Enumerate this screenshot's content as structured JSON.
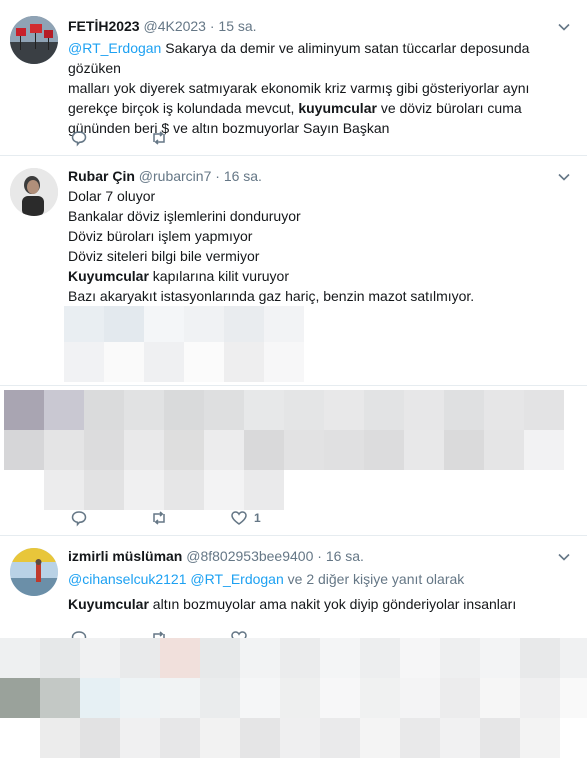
{
  "tweets": [
    {
      "fullname": "FETİH2023",
      "handle": "@4K2023",
      "sep": "·",
      "time": "15 sa.",
      "mention": "@RT_Erdogan",
      "lines": [
        " Sakarya da demir ve aliminyum satan tüccarlar deposunda gözüken",
        "malları yok diyerek satmıyarak ekonomik kriz varmış gibi gösteriyorlar aynı",
        "gerekçe birçok iş kolundada mevcut, ",
        "kuyumcular",
        " ve döviz büroları cuma",
        "gününden beri $ ve altın bozmuyorlar Sayın Başkan"
      ]
    },
    {
      "fullname": "Rubar Çin",
      "handle": "@rubarcin7",
      "sep": "·",
      "time": "16 sa.",
      "lines": [
        "Dolar 7 oluyor",
        "Bankalar döviz işlemlerini donduruyor",
        "Döviz büroları işlem yapmıyor",
        "Döviz siteleri bilgi bile vermiyor",
        "Kuyumcular",
        " kapılarına kilit vuruyor",
        "Bazı akaryakıt istasyonlarında gaz hariç, benzin mazot satılmıyor."
      ]
    },
    {
      "like_count": "1"
    },
    {
      "fullname": "izmirli müslüman",
      "handle": "@8f802953bee9400",
      "sep": "·",
      "time": "16 sa.",
      "reply_mention_1": "@cihanselcuk2121",
      "reply_mention_2": "@RT_Erdogan",
      "reply_suffix": " ve 2 diğer kişiye yanıt olarak",
      "text_strong": "Kuyumcular",
      "text_rest": " altın bozmuyolar ama nakit yok diyip gönderiyolar insanları"
    }
  ],
  "colors": {
    "accent": "#1da1f2",
    "meta": "#657786",
    "border": "#e6ecf0"
  }
}
